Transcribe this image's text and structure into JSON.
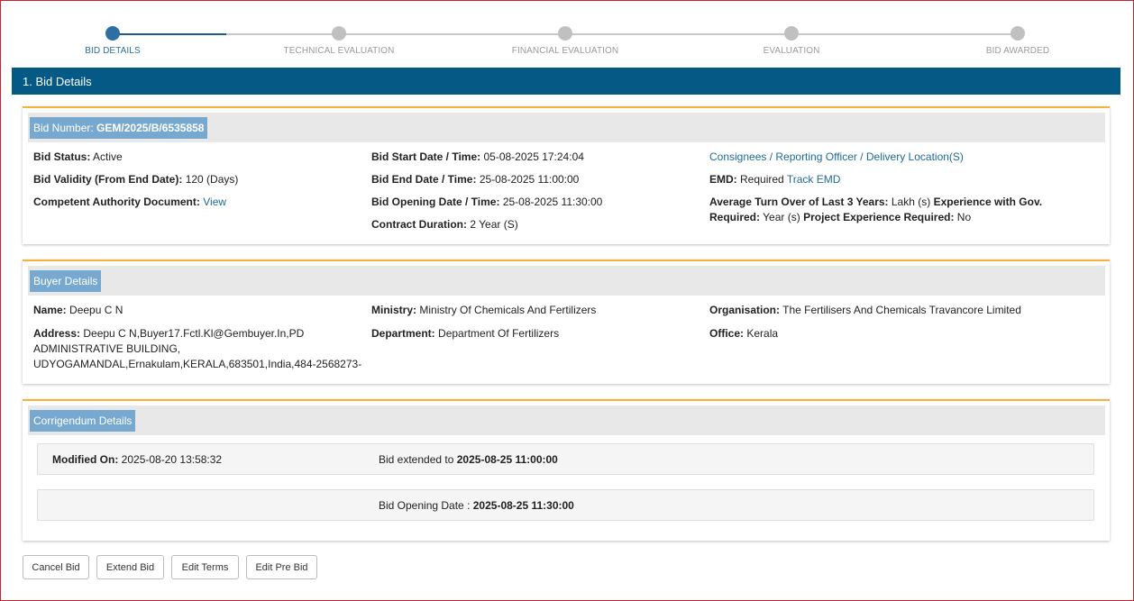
{
  "stepper": {
    "steps": [
      {
        "label": "BID DETAILS",
        "active": true
      },
      {
        "label": "TECHNICAL EVALUATION",
        "active": false
      },
      {
        "label": "FINANCIAL EVALUATION",
        "active": false
      },
      {
        "label": "EVALUATION",
        "active": false
      },
      {
        "label": "BID AWARDED",
        "active": false
      }
    ]
  },
  "section": {
    "title": "1. Bid Details"
  },
  "bid": {
    "number_label": "Bid Number:",
    "number_value": "GEM/2025/B/6535858",
    "status_label": "Bid Status:",
    "status_value": "Active",
    "validity_label": "Bid Validity (From End Date):",
    "validity_value": "120 (Days)",
    "authority_label": "Competent Authority Document:",
    "authority_link": "View",
    "start_label": "Bid Start Date / Time:",
    "start_value": "05-08-2025 17:24:04",
    "end_label": "Bid End Date / Time:",
    "end_value": "25-08-2025 11:00:00",
    "opening_label": "Bid Opening Date / Time:",
    "opening_value": "25-08-2025 11:30:00",
    "duration_label": "Contract Duration:",
    "duration_value": "2 Year (S)",
    "consignees_link": "Consignees / Reporting Officer / Delivery Location(S)",
    "emd_label": "EMD:",
    "emd_value": "Required",
    "emd_link": "Track EMD",
    "turnover_label": "Average Turn Over of Last 3 Years:",
    "turnover_value": "Lakh (s)",
    "experience_label_1": "Experience with Gov.",
    "experience_label_2": "Required:",
    "experience_value": "Year (s)",
    "project_label": "Project Experience Required:",
    "project_value": "No"
  },
  "buyer": {
    "title": "Buyer Details",
    "name_label": "Name:",
    "name_value": "Deepu C N",
    "address_label": "Address:",
    "address_line1": "Deepu C N,Buyer17.Fctl.Kl@Gembuyer.In,PD",
    "address_line2": "ADMINISTRATIVE BUILDING,",
    "address_line3": "UDYOGAMANDAL,Ernakulam,KERALA,683501,India,484-2568273-",
    "ministry_label": "Ministry:",
    "ministry_value": "Ministry Of Chemicals And Fertilizers",
    "department_label": "Department:",
    "department_value": "Department Of Fertilizers",
    "organisation_label": "Organisation:",
    "organisation_value": "The Fertilisers And Chemicals Travancore Limited",
    "office_label": "Office:",
    "office_value": "Kerala"
  },
  "corrigendum": {
    "title": "Corrigendum Details",
    "modified_label": "Modified On:",
    "modified_value": "2025-08-20 13:58:32",
    "extended_text": "Bid extended to",
    "extended_value": "2025-08-25 11:00:00",
    "opening_text": "Bid Opening Date :",
    "opening_value": "2025-08-25 11:30:00"
  },
  "actions": {
    "cancel": "Cancel Bid",
    "extend": "Extend Bid",
    "edit_terms": "Edit Terms",
    "edit_prebid": "Edit Pre Bid"
  },
  "colors": {
    "header_bg": "#055a85",
    "accent_border": "#f4b13d",
    "tag_bg": "#77a9d0",
    "link": "#1f6a9a",
    "frame_border": "#c0262d"
  }
}
